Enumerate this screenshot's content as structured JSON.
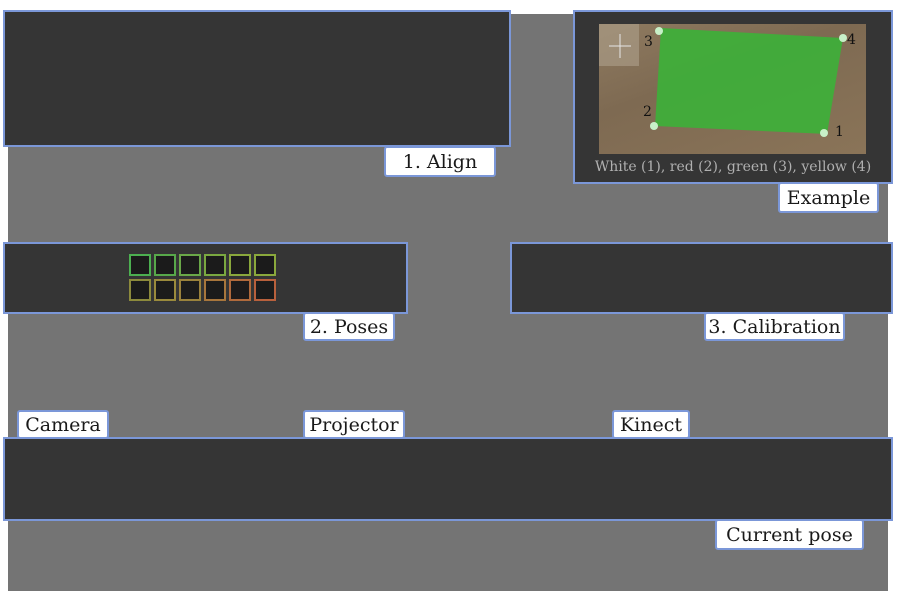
{
  "align": {
    "label": "1. Align"
  },
  "example": {
    "label": "Example",
    "caption": "White (1),  red (2), green (3), yellow (4)",
    "corners": [
      "1",
      "2",
      "3",
      "4"
    ],
    "overlay_color": "#3fae3a"
  },
  "poses": {
    "label": "2. Poses",
    "row1_colors": [
      "#4caf50",
      "#57a84a",
      "#6aa848",
      "#7aa840",
      "#8aa83c",
      "#8aa83c"
    ],
    "row2_colors": [
      "#8c8a3c",
      "#9a8a3c",
      "#9a823c",
      "#a8763c",
      "#b06a3c",
      "#b8603c"
    ]
  },
  "calibration": {
    "label": "3. Calibration"
  },
  "devices": {
    "camera": "Camera",
    "projector": "Projector",
    "kinect": "Kinect"
  },
  "current_pose": {
    "label": "Current pose"
  }
}
